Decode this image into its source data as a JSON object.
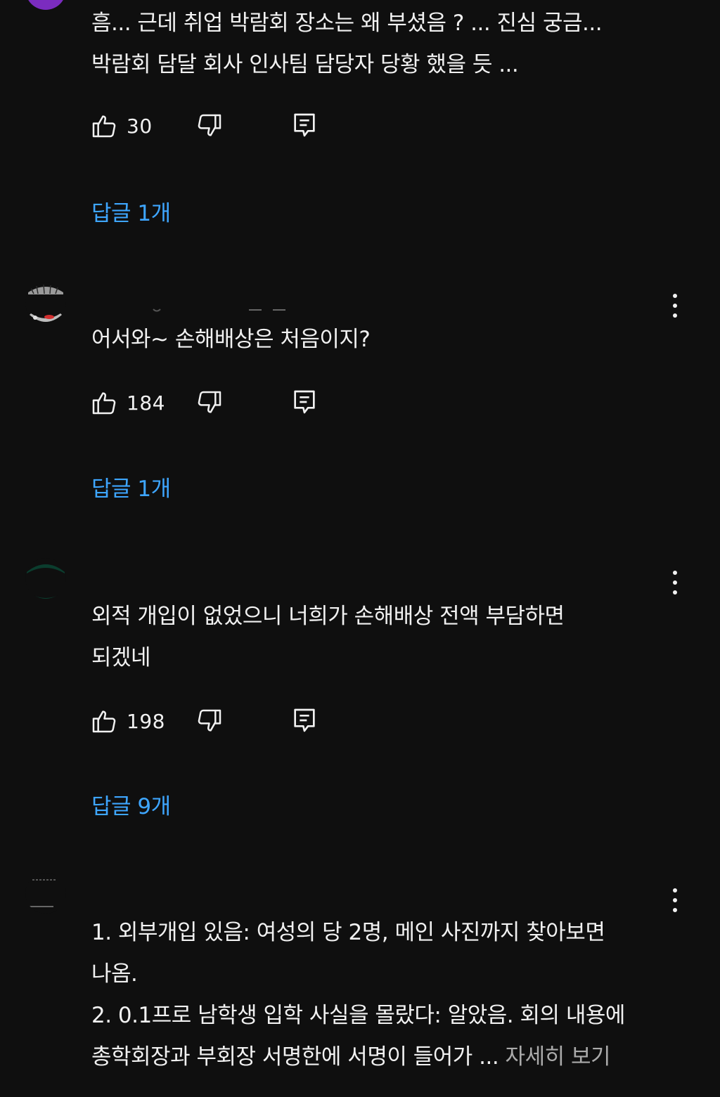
{
  "comments": [
    {
      "text_lines": [
        "흠... 근데 취업 박람회 장소는  왜  부셨음 ? ... 진심 궁금...",
        "박람회 담달 회사 인사팀  담당자 당황 했을 듯 ..."
      ],
      "likes": "30",
      "replies_label": "답글 1개",
      "avatar_color": "#7b2cbf"
    },
    {
      "text_lines": [
        "어서와~ 손해배상은 처음이지?"
      ],
      "likes": "184",
      "replies_label": "답글 1개"
    },
    {
      "text_lines": [
        "외적 개입이 없었으니 너희가 손해배상 전액 부담하면",
        "되겠네"
      ],
      "likes": "198",
      "replies_label": "답글 9개",
      "avatar_color": "#0b3d2e"
    },
    {
      "text_lines": [
        "1. 외부개입 있음: 여성의 당 2명, 메인 사진까지 찾아보면",
        "나옴.",
        "2. 0.1프로 남학생 입학 사실을 몰랐다: 알았음. 회의 내용에",
        "총학회장과 부회장 서명한에 서명이 들어가 ... "
      ],
      "read_more": "자세히 보기"
    }
  ],
  "icons": {
    "like": "thumbs-up-icon",
    "dislike": "thumbs-down-icon",
    "reply": "reply-icon",
    "menu": "more-vert-icon"
  },
  "colors": {
    "background": "#0f0f0f",
    "text": "#f1f1f1",
    "link": "#3ea6ff",
    "muted": "#aaaaaa"
  }
}
